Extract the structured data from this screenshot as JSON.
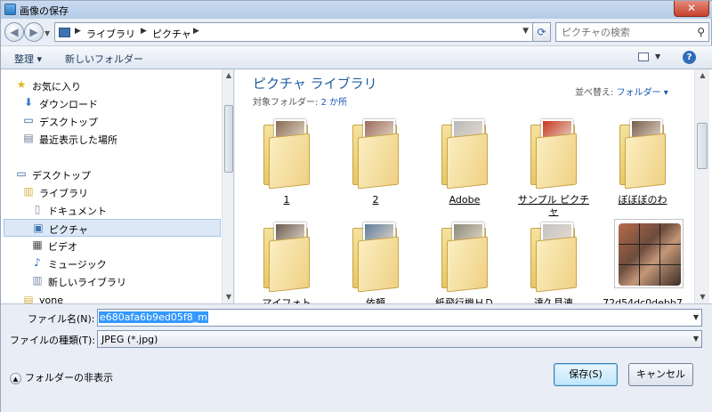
{
  "window": {
    "title": "画像の保存",
    "close_label": "✕"
  },
  "address": {
    "crumbs": [
      "ライブラリ",
      "ピクチャ"
    ],
    "search_placeholder": "ピクチャの検索"
  },
  "toolbar": {
    "organize_label": "整理 ▾",
    "new_folder_label": "新しいフォルダー"
  },
  "nav": {
    "favorites": [
      {
        "label": "お気に入り",
        "icon": "star-icon"
      },
      {
        "label": "ダウンロード",
        "icon": "download-icon"
      },
      {
        "label": "デスクトップ",
        "icon": "desktop-icon"
      },
      {
        "label": "最近表示した場所",
        "icon": "recent-places-icon"
      }
    ],
    "tree": [
      {
        "label": "デスクトップ",
        "icon": "desktop-icon"
      },
      {
        "label": "ライブラリ",
        "icon": "library-icon"
      },
      {
        "label": "ドキュメント",
        "icon": "documents-icon"
      },
      {
        "label": "ピクチャ",
        "icon": "pictures-icon",
        "selected": true
      },
      {
        "label": "ビデオ",
        "icon": "video-icon"
      },
      {
        "label": "ミュージック",
        "icon": "music-icon"
      },
      {
        "label": "新しいライブラリ",
        "icon": "library-icon"
      },
      {
        "label": "yone",
        "icon": "user-folder-icon"
      }
    ]
  },
  "content": {
    "library_title": "ピクチャ ライブラリ",
    "target_label": "対象フォルダー:",
    "target_value": "2 か所",
    "sort_label": "並べ替え:",
    "sort_value": "フォルダー ▾",
    "items": [
      {
        "label": "1",
        "type": "folder",
        "photo_color": "#8a6a52"
      },
      {
        "label": "2",
        "type": "folder",
        "photo_color": "#9c6b5a"
      },
      {
        "label": "Adobe",
        "type": "folder",
        "photo_color": "#b9b9b9"
      },
      {
        "label": "サンプル ピクチャ",
        "type": "folder",
        "photo_color": "#c8381f"
      },
      {
        "label": "ぼぼぼのわ",
        "type": "folder",
        "photo_color": "#7a5c4b"
      },
      {
        "label": "マイフォト",
        "type": "folder",
        "photo_color": "#6b5b52"
      },
      {
        "label": "依頼",
        "type": "folder",
        "photo_color": "#5f7c9a"
      },
      {
        "label": "紙飛行機ＨＤ",
        "type": "folder",
        "photo_color": "#8a8a7a"
      },
      {
        "label": "達久見連",
        "type": "folder",
        "photo_color": "#c3c3c3"
      },
      {
        "label": "72d54dc0debb7",
        "type": "image",
        "photo_color": "#6d4c3d"
      }
    ]
  },
  "form": {
    "filename_label": "ファイル名(N):",
    "filename_value": "e680afa6b9ed05f8_m",
    "filetype_label": "ファイルの種類(T):",
    "filetype_value": "JPEG (*.jpg)",
    "hide_folders_label": "フォルダーの非表示",
    "save_label": "保存(S)",
    "cancel_label": "キャンセル"
  },
  "colors": {
    "accent": "#1e5e9e",
    "selection": "#3399ff",
    "folder": "#f0d27e"
  }
}
